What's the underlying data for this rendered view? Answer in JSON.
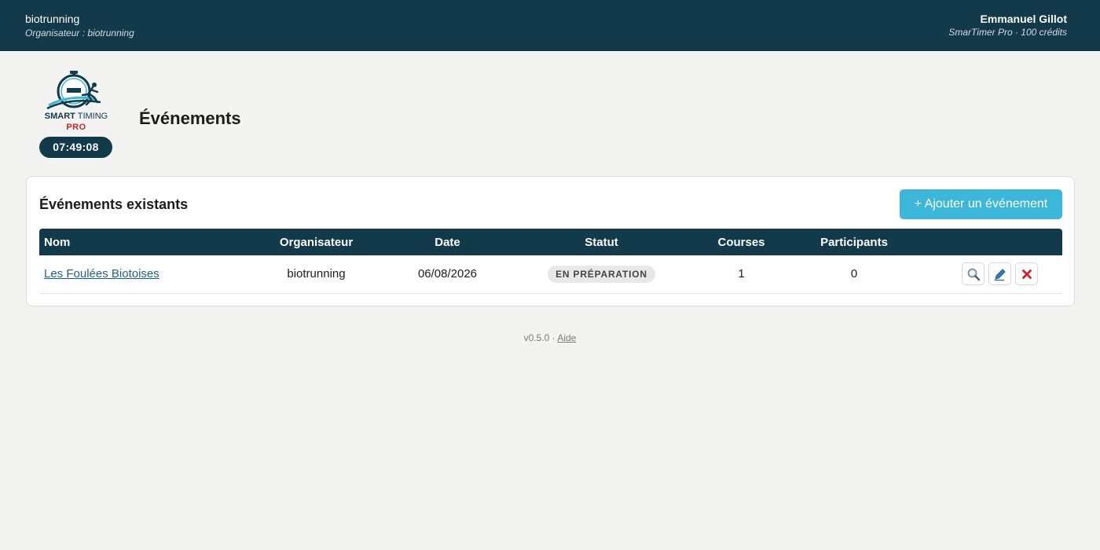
{
  "header": {
    "org_name": "biotrunning",
    "org_sub": "Organisateur : biotrunning",
    "user_name": "Emmanuel Gillot",
    "user_sub": "SmarTimer Pro · 100 crédits"
  },
  "brand": {
    "logo_word_1": "SMART",
    "logo_word_2": "TIMING",
    "logo_pro": "PRO",
    "clock": "07:49:08"
  },
  "page": {
    "title": "Événements"
  },
  "events_card": {
    "title": "Événements existants",
    "add_button": "+ Ajouter un événement",
    "columns": [
      "Nom",
      "Organisateur",
      "Date",
      "Statut",
      "Courses",
      "Participants",
      ""
    ],
    "rows": [
      {
        "name": "Les Foulées Biotoises",
        "organizer": "biotrunning",
        "date": "06/08/2026",
        "status": "EN PRÉPARATION",
        "courses": "1",
        "participants": "0",
        "actions": [
          "view-icon",
          "edit-icon",
          "delete-icon"
        ]
      }
    ]
  },
  "footer": {
    "version": "v0.5.0 · ",
    "help_link": "Aide"
  },
  "colors": {
    "header_bg": "#133a4a",
    "accent": "#3cb7d9",
    "delete": "#c8262b",
    "page_bg": "#f3f3f2"
  }
}
